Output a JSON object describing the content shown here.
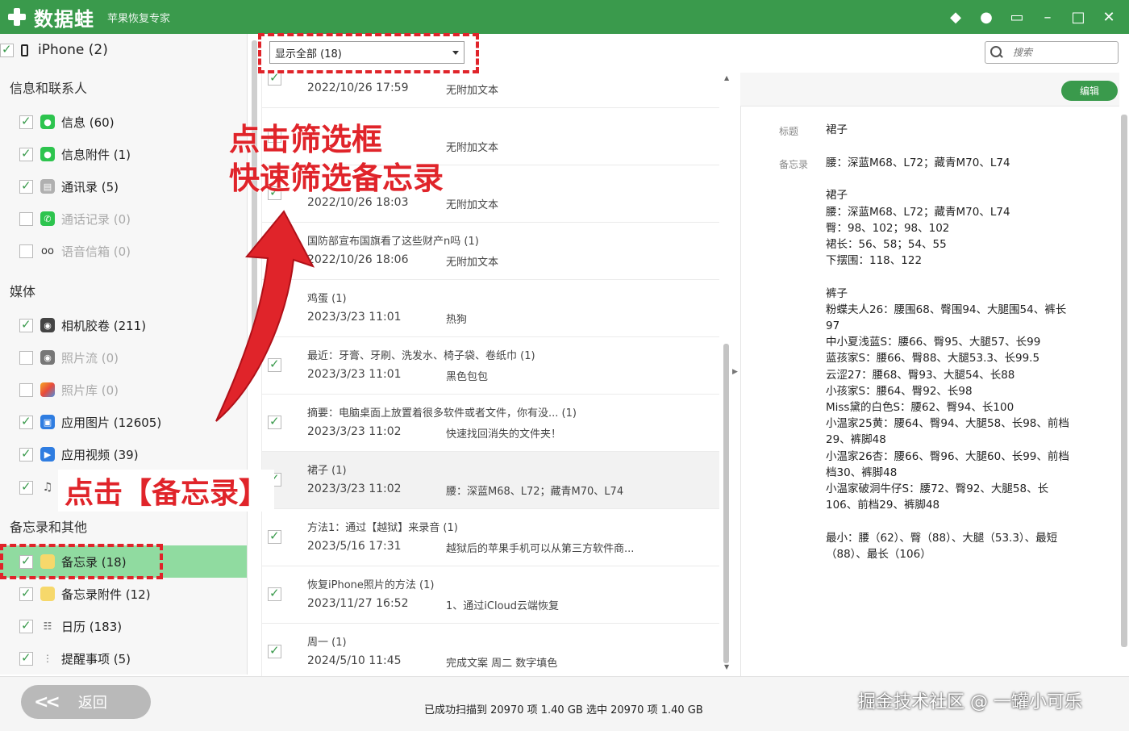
{
  "app": {
    "name": "数据蛙",
    "subtitle": "苹果恢复专家",
    "window_controls": [
      "diamond-icon",
      "chat-icon",
      "monitor-icon",
      "minimize-icon",
      "maximize-icon",
      "close-icon"
    ]
  },
  "sidebar": {
    "device": "iPhone (2)",
    "sections": [
      {
        "title": "信息和联系人",
        "items": [
          {
            "label": "信息 (60)",
            "checked": true,
            "enabled": true,
            "icon": "messages-icon"
          },
          {
            "label": "信息附件 (1)",
            "checked": true,
            "enabled": true,
            "icon": "message-attachment-icon"
          },
          {
            "label": "通讯录 (5)",
            "checked": true,
            "enabled": true,
            "icon": "contacts-icon"
          },
          {
            "label": "通话记录 (0)",
            "checked": false,
            "enabled": false,
            "icon": "phone-icon"
          },
          {
            "label": "语音信箱 (0)",
            "checked": false,
            "enabled": false,
            "icon": "voicemail-icon"
          }
        ]
      },
      {
        "title": "媒体",
        "items": [
          {
            "label": "相机胶卷 (211)",
            "checked": true,
            "enabled": true,
            "icon": "camera-roll-icon"
          },
          {
            "label": "照片流 (0)",
            "checked": false,
            "enabled": false,
            "icon": "photo-stream-icon"
          },
          {
            "label": "照片库 (0)",
            "checked": false,
            "enabled": false,
            "icon": "photo-library-icon"
          },
          {
            "label": "应用图片 (12605)",
            "checked": true,
            "enabled": true,
            "icon": "app-photos-icon"
          },
          {
            "label": "应用视频 (39)",
            "checked": true,
            "enabled": true,
            "icon": "app-videos-icon"
          },
          {
            "label": "",
            "checked": true,
            "enabled": true,
            "icon": "music-icon"
          }
        ]
      },
      {
        "title": "备忘录和其他",
        "items": [
          {
            "label": "备忘录 (18)",
            "checked": true,
            "enabled": true,
            "icon": "notes-icon",
            "active": true
          },
          {
            "label": "备忘录附件 (12)",
            "checked": true,
            "enabled": true,
            "icon": "notes-attachment-icon"
          },
          {
            "label": "日历 (183)",
            "checked": true,
            "enabled": true,
            "icon": "calendar-icon"
          },
          {
            "label": "提醒事项 (5)",
            "checked": true,
            "enabled": true,
            "icon": "reminders-icon"
          }
        ]
      }
    ]
  },
  "filter": {
    "selected": "显示全部 (18)"
  },
  "search": {
    "placeholder": "搜索"
  },
  "list": {
    "rows": [
      {
        "title": "",
        "date": "2022/10/26 17:59",
        "desc": "无附加文本",
        "checked": true
      },
      {
        "title": "",
        "date": "",
        "desc": "无附加文本",
        "checked": true
      },
      {
        "title": "",
        "date": "2022/10/26 18:03",
        "desc": "无附加文本",
        "checked": true
      },
      {
        "title": "国防部宣布国旗看了这些财产n吗 (1)",
        "date": "2022/10/26 18:06",
        "desc": "无附加文本",
        "checked": true
      },
      {
        "title": "鸡蛋 (1)",
        "date": "2023/3/23 11:01",
        "desc": "热狗",
        "checked": true
      },
      {
        "title": "最近：牙膏、牙刷、洗发水、椅子袋、卷纸巾 (1)",
        "date": "2023/3/23 11:01",
        "desc": "黑色包包",
        "checked": true
      },
      {
        "title": "摘要：电脑桌面上放置着很多软件或者文件，你有没... (1)",
        "date": "2023/3/23 11:02",
        "desc": "快速找回消失的文件夹！",
        "checked": true
      },
      {
        "title": "裙子 (1)",
        "date": "2023/3/23 11:02",
        "desc": "腰：深蓝M68、L72；藏青M70、L74",
        "checked": true,
        "selected": true
      },
      {
        "title": "方法1：通过【越狱】来录音 (1)",
        "date": "2023/5/16 17:31",
        "desc": "越狱后的苹果手机可以从第三方软件商...",
        "checked": true
      },
      {
        "title": "恢复iPhone照片的方法 (1)",
        "date": "2023/11/27 16:52",
        "desc": "1、通过iCloud云端恢复",
        "checked": true
      },
      {
        "title": "周一 (1)",
        "date": "2024/5/10 11:45",
        "desc": "完成文案 周二 数字填色",
        "checked": true
      }
    ]
  },
  "detail": {
    "edit_label": "编辑",
    "title_label": "标题",
    "title_value": "裙子",
    "note_label": "备忘录",
    "note_text": "腰：深蓝M68、L72；藏青M70、L74\n\n裙子\n腰：深蓝M68、L72；藏青M70、L74\n臀：98、102；98、102\n裙长：56、58；54、55\n下摆围：118、122\n\n裤子\n粉蝶夫人26：腰围68、臀围94、大腿围54、裤长97\n中小夏浅蓝S：腰66、臀95、大腿57、长99\n蓝孩家S：腰66、臀88、大腿53.3、长99.5\n云涩27：腰68、臀93、大腿54、长88\n小孩家S：腰64、臀92、长98\nMiss黛的白色S：腰62、臀94、长100\n小温家25黄：腰64、臀94、大腿58、长98、前档29、裤脚48\n小温家26杏：腰66、臀96、大腿60、长99、前档档30、裤脚48\n小温家破洞牛仔S：腰72、臀92、大腿58、长106、前档29、裤脚48\n\n最小：腰（62）、臀（88）、大腿（53.3）、最短（88）、最长（106）"
  },
  "footer": {
    "back_label": "返回",
    "status": "已成功扫描到 20970 项 1.40 GB  选中 20970 项 1.40 GB",
    "watermark": "掘金技术社区 @ 一罐小可乐"
  },
  "annotations": {
    "filter_hint_line1": "点击筛选框",
    "filter_hint_line2": "快速筛选备忘录",
    "notes_hint": "点击【备忘录】",
    "color": "#e0242a"
  },
  "colors": {
    "brand_green": "#3a9a4c",
    "active_row": "#90dba0",
    "annotation_red": "#e0242a"
  }
}
